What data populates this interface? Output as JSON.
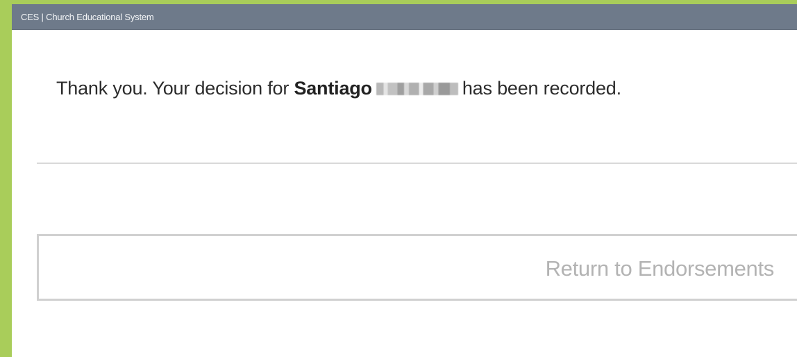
{
  "window": {
    "title": "CES | Church Educational System"
  },
  "confirmation": {
    "prefix": "Thank you. Your decision for",
    "name_first": "Santiago",
    "suffix": "has been recorded."
  },
  "actions": {
    "return_label": "Return to Endorsements"
  },
  "colors": {
    "outer_frame": "#a9cd5a",
    "titlebar": "#6e7a8a",
    "button_text": "#b3b3b3"
  }
}
